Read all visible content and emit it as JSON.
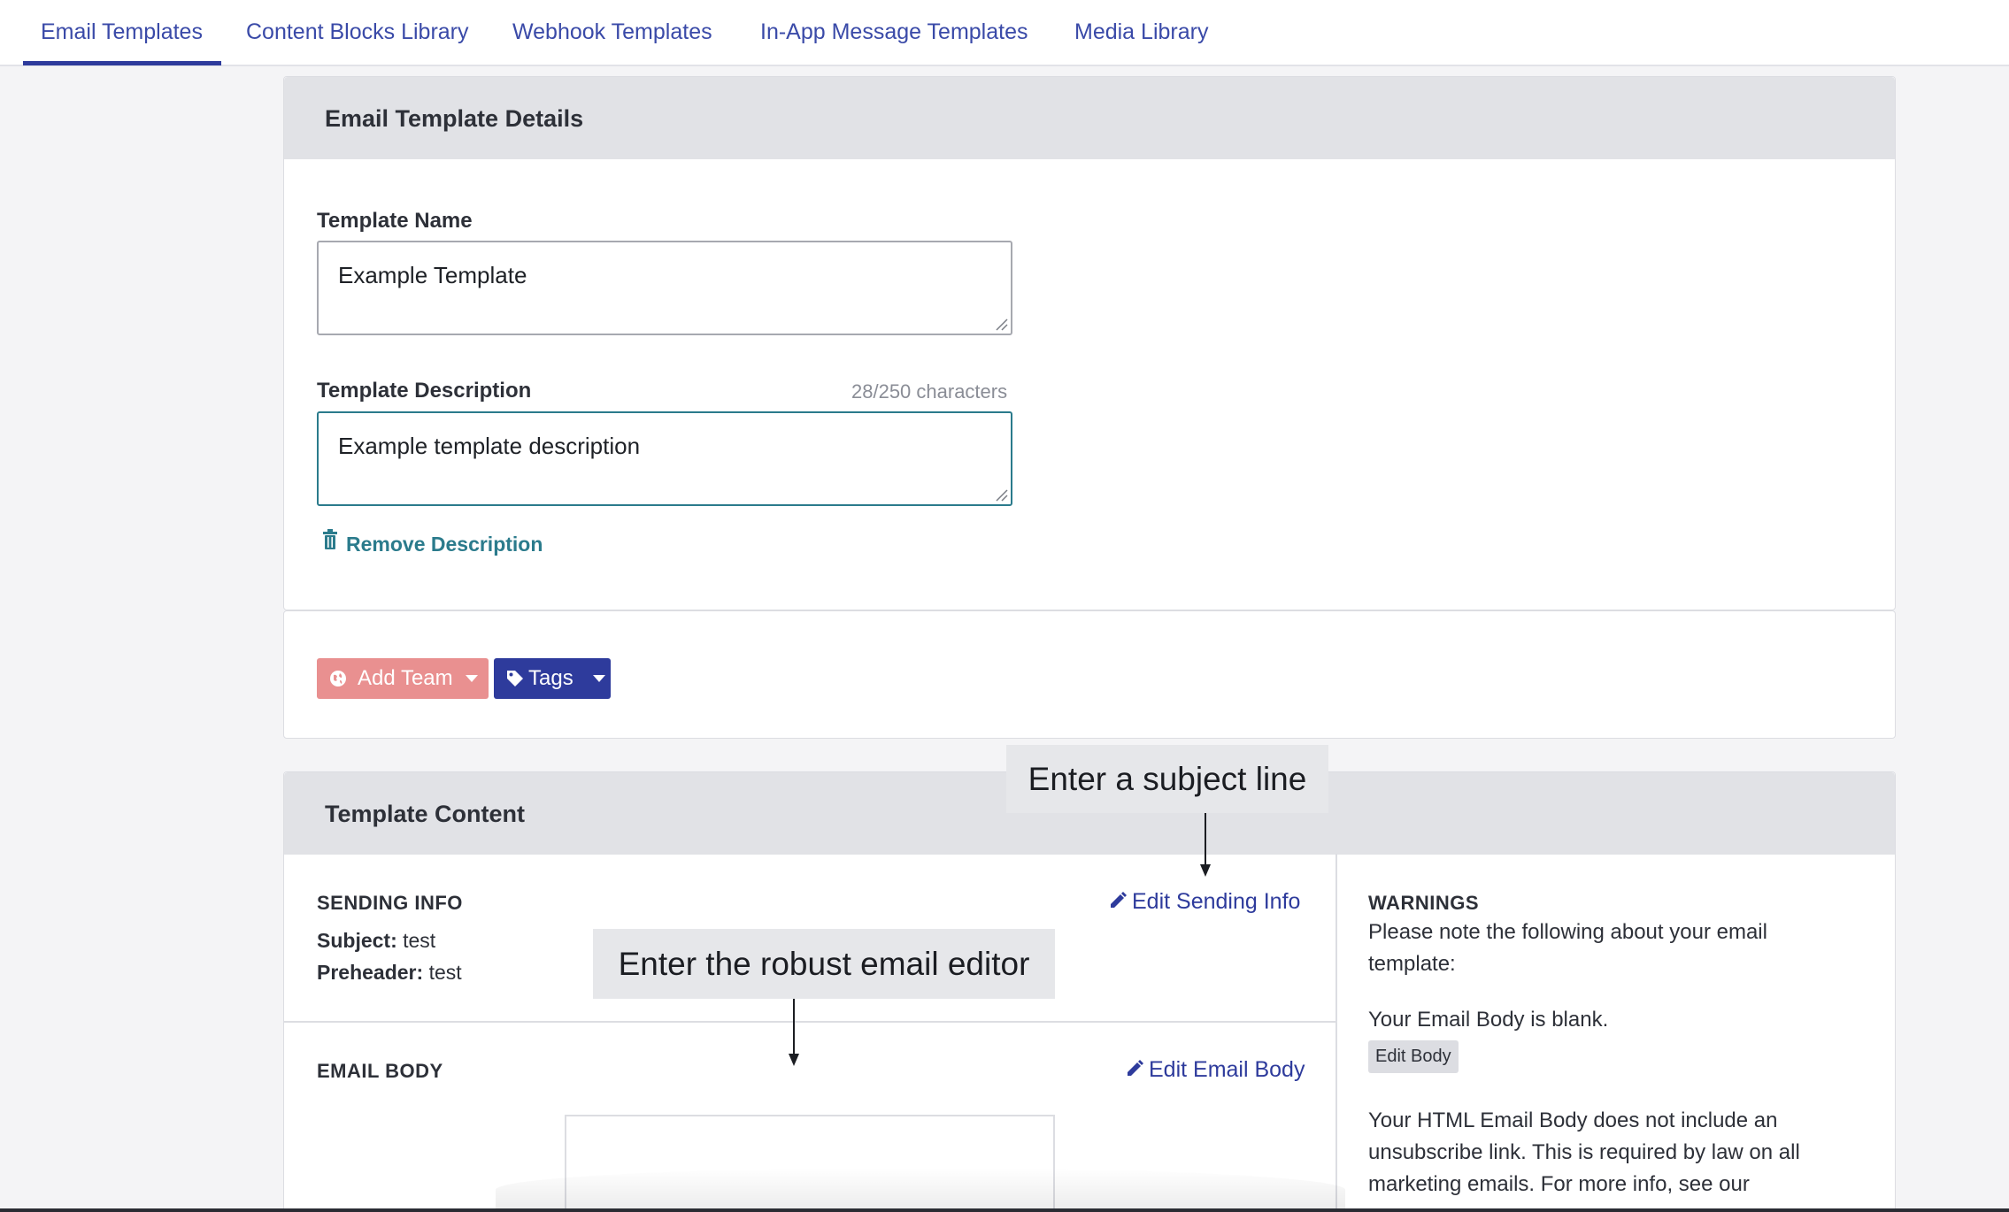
{
  "nav": {
    "tabs": [
      {
        "label": "Email Templates",
        "active": true
      },
      {
        "label": "Content Blocks Library"
      },
      {
        "label": "Webhook Templates"
      },
      {
        "label": "In-App Message Templates"
      },
      {
        "label": "Media Library"
      }
    ]
  },
  "details": {
    "title": "Email Template Details",
    "name_label": "Template Name",
    "name_value": "Example Template",
    "description_label": "Template Description",
    "char_count": "28/250 characters",
    "description_value": "Example template description",
    "remove_description": "Remove Description"
  },
  "actions": {
    "add_team": "Add Team",
    "tags": "Tags"
  },
  "content": {
    "title": "Template Content",
    "sending_info_label": "SENDING INFO",
    "subject_key": "Subject:",
    "subject_value": "test",
    "preheader_key": "Preheader:",
    "preheader_value": "test",
    "edit_sending_info": "Edit Sending Info",
    "email_body_label": "EMAIL BODY",
    "edit_email_body": "Edit Email Body"
  },
  "warnings": {
    "label": "WARNINGS",
    "intro": "Please note the following about your email template:",
    "blank_body": "Your Email Body is blank.",
    "edit_body_badge": "Edit Body",
    "unsubscribe": "Your HTML Email Body does not include an unsubscribe link. This is required by law on all marketing emails. For more info, see our"
  },
  "callouts": {
    "subject": "Enter a subject line",
    "editor": "Enter the robust email editor"
  },
  "colors": {
    "accent": "#2e3b9c",
    "teal": "#2b7b8c",
    "team_button": "#e99090"
  }
}
